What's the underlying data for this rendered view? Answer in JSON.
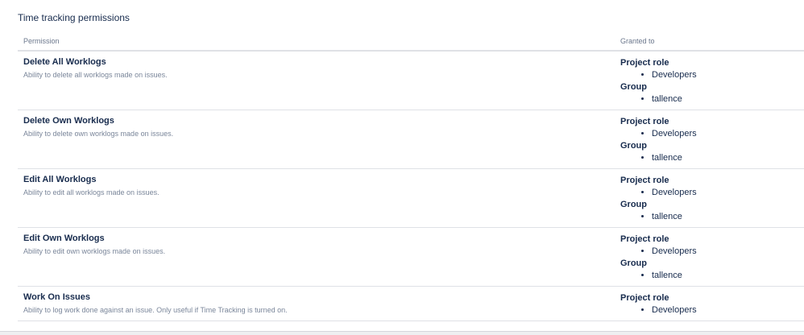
{
  "section": {
    "title": "Time tracking permissions"
  },
  "table": {
    "headers": {
      "permission": "Permission",
      "granted_to": "Granted to"
    },
    "rows": [
      {
        "name": "Delete All Worklogs",
        "description": "Ability to delete all worklogs made on issues.",
        "project_role_label": "Project role",
        "project_role": "Developers",
        "group_label": "Group",
        "group": "tallence"
      },
      {
        "name": "Delete Own Worklogs",
        "description": "Ability to delete own worklogs made on issues.",
        "project_role_label": "Project role",
        "project_role": "Developers",
        "group_label": "Group",
        "group": "tallence"
      },
      {
        "name": "Edit All Worklogs",
        "description": "Ability to edit all worklogs made on issues.",
        "project_role_label": "Project role",
        "project_role": "Developers",
        "group_label": "Group",
        "group": "tallence"
      },
      {
        "name": "Edit Own Worklogs",
        "description": "Ability to edit own worklogs made on issues.",
        "project_role_label": "Project role",
        "project_role": "Developers",
        "group_label": "Group",
        "group": "tallence"
      },
      {
        "name": "Work On Issues",
        "description": "Ability to log work done against an issue. Only useful if Time Tracking is turned on.",
        "project_role_label": "Project role",
        "project_role": "Developers"
      }
    ]
  }
}
